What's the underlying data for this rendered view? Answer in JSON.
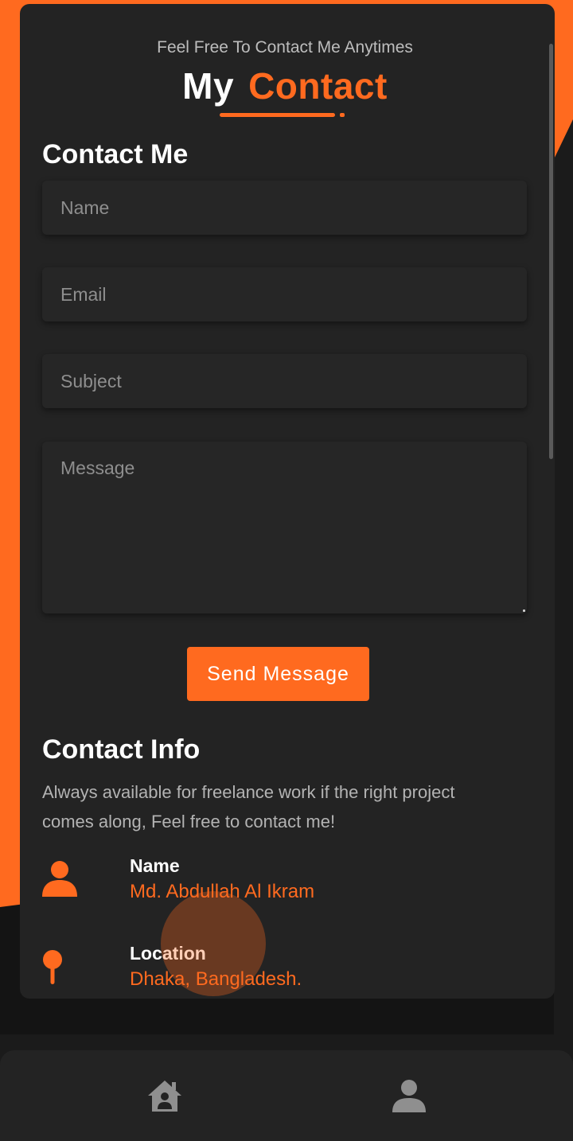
{
  "header": {
    "subtitle": "Feel Free To Contact Me Anytimes",
    "title_word1": "My",
    "title_word2": "Contact"
  },
  "form": {
    "title": "Contact Me",
    "name_placeholder": "Name",
    "email_placeholder": "Email",
    "subject_placeholder": "Subject",
    "message_placeholder": "Message",
    "send_label": "Send Message"
  },
  "info": {
    "title": "Contact Info",
    "description": "Always available for freelance work if the right project comes along, Feel free to contact me!",
    "items": [
      {
        "label": "Name",
        "value": "Md. Abdullah Al Ikram",
        "icon": "user-icon"
      },
      {
        "label": "Location",
        "value": "Dhaka, Bangladesh.",
        "icon": "map-pin-icon"
      }
    ]
  },
  "nav": {
    "items": [
      {
        "icon": "home-icon"
      },
      {
        "icon": "user-icon"
      }
    ]
  },
  "colors": {
    "accent": "#ff6a1f",
    "card": "#232323",
    "background": "#1b1b1b"
  }
}
